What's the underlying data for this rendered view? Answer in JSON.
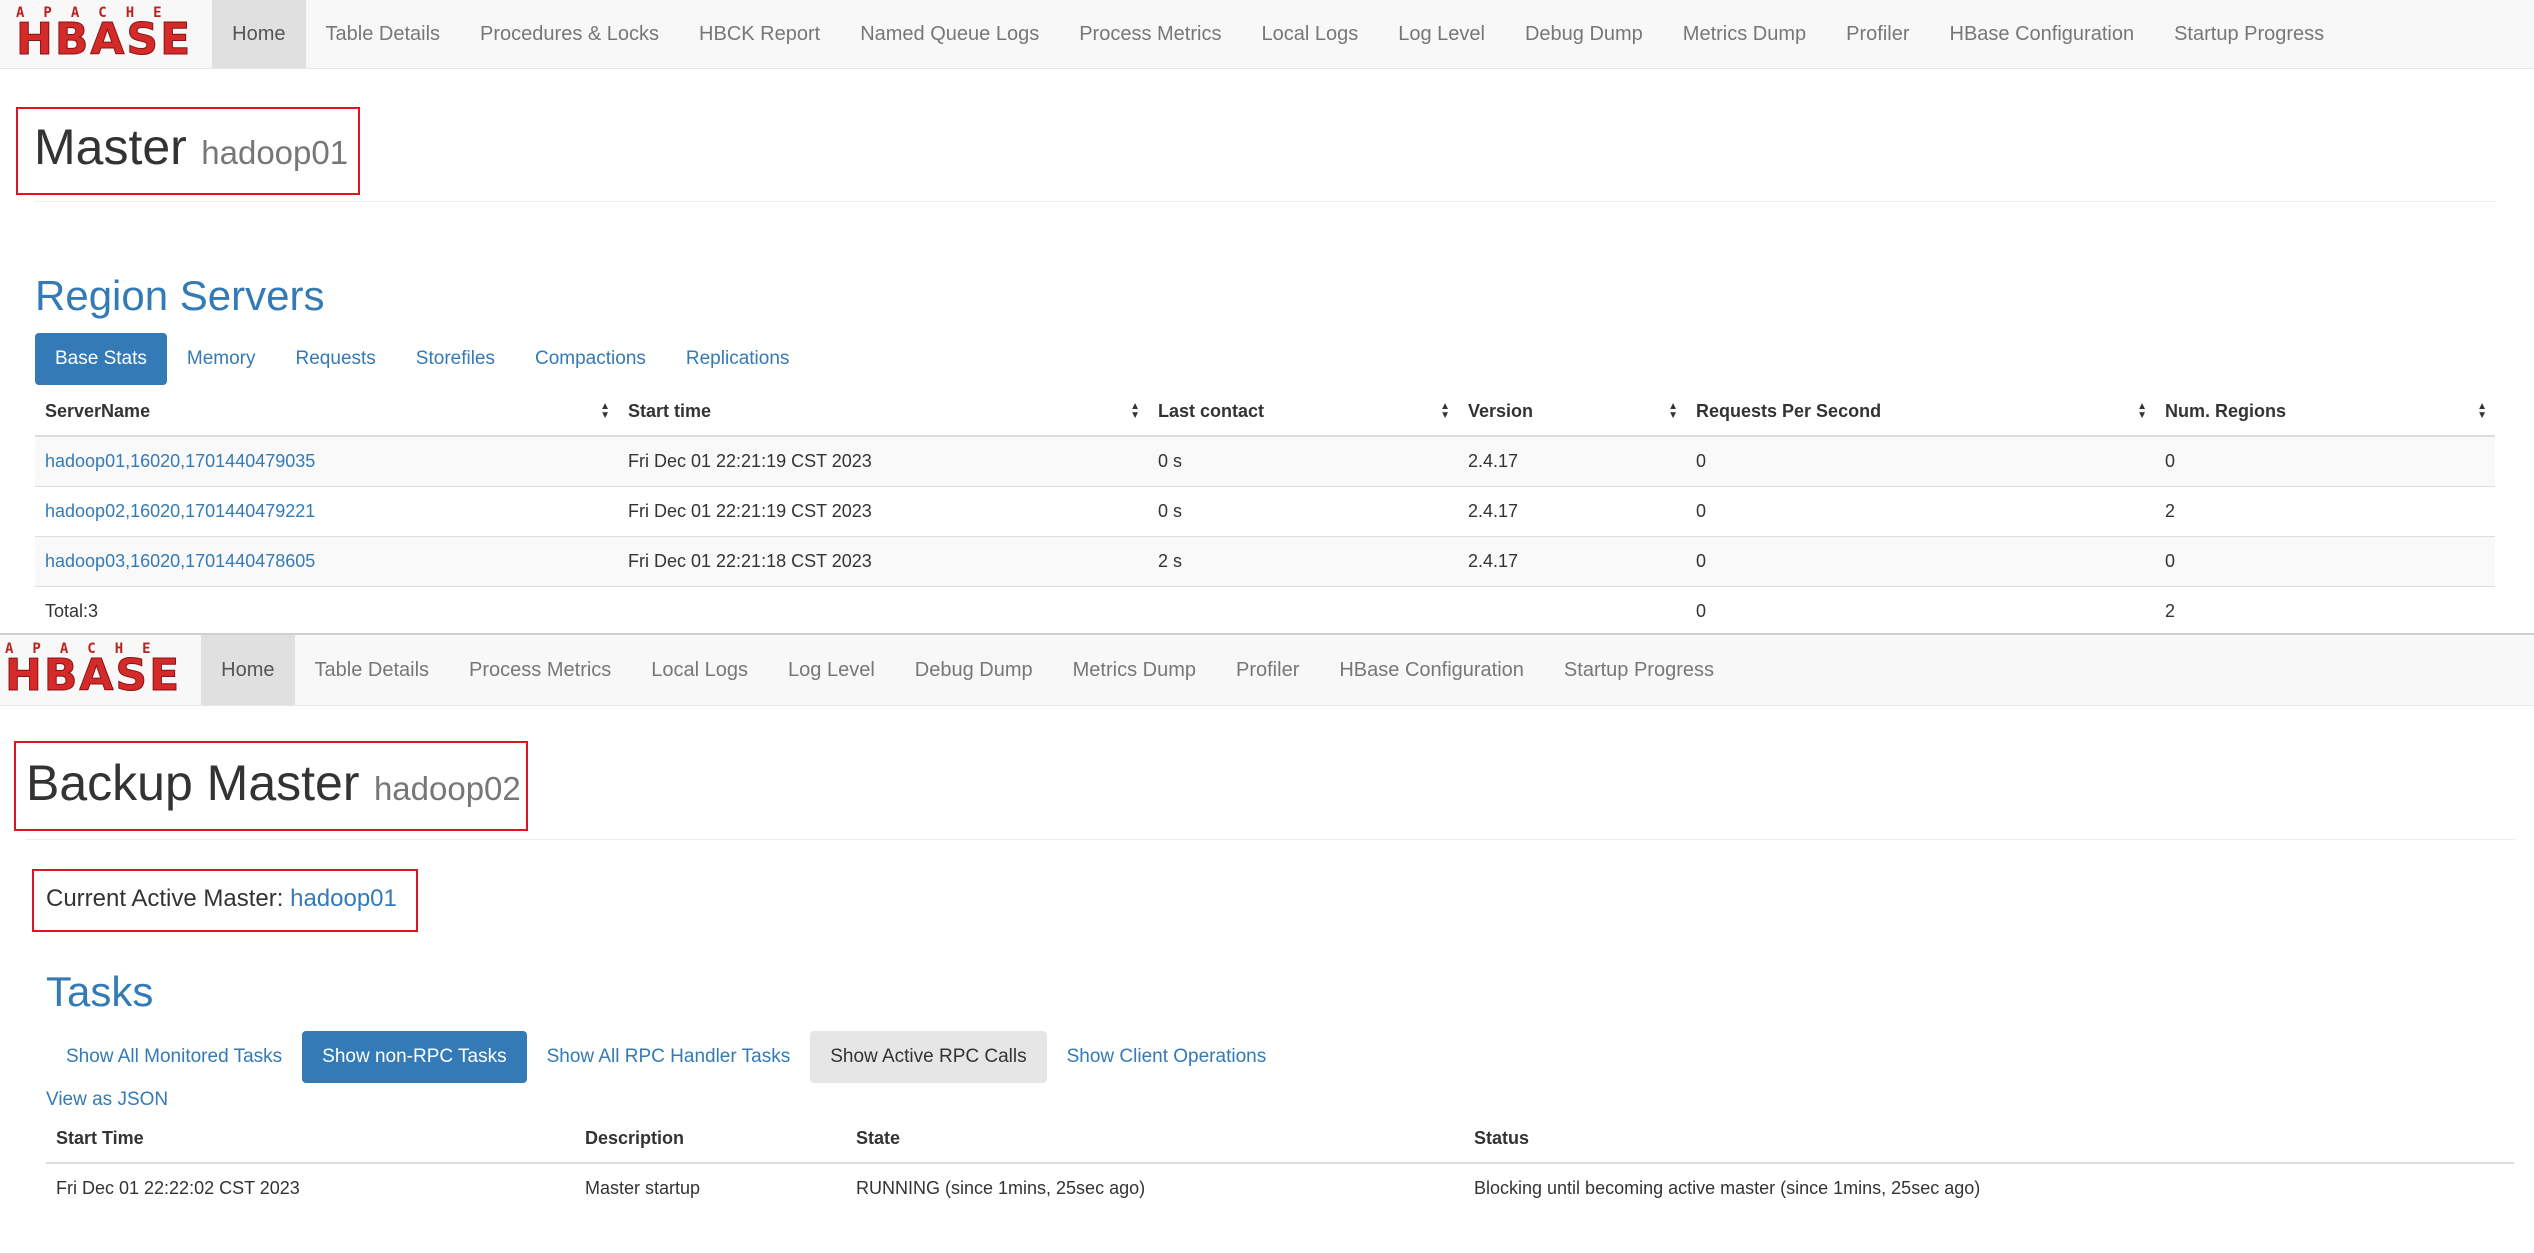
{
  "master_page": {
    "logo": {
      "apache": "APACHE",
      "hbase": "HBASE"
    },
    "nav": [
      "Home",
      "Table Details",
      "Procedures & Locks",
      "HBCK Report",
      "Named Queue Logs",
      "Process Metrics",
      "Local Logs",
      "Log Level",
      "Debug Dump",
      "Metrics Dump",
      "Profiler",
      "HBase Configuration",
      "Startup Progress"
    ],
    "header": {
      "title": "Master",
      "host": "hadoop01"
    },
    "region_servers": {
      "title": "Region Servers",
      "tabs": [
        "Base Stats",
        "Memory",
        "Requests",
        "Storefiles",
        "Compactions",
        "Replications"
      ],
      "columns": [
        "ServerName",
        "Start time",
        "Last contact",
        "Version",
        "Requests Per Second",
        "Num. Regions"
      ],
      "rows": [
        [
          "hadoop01,16020,1701440479035",
          "Fri Dec 01 22:21:19 CST 2023",
          "0 s",
          "2.4.17",
          "0",
          "0"
        ],
        [
          "hadoop02,16020,1701440479221",
          "Fri Dec 01 22:21:19 CST 2023",
          "0 s",
          "2.4.17",
          "0",
          "2"
        ],
        [
          "hadoop03,16020,1701440478605",
          "Fri Dec 01 22:21:18 CST 2023",
          "2 s",
          "2.4.17",
          "0",
          "0"
        ]
      ],
      "total": {
        "label": "Total:3",
        "requests": "0",
        "regions": "2"
      }
    }
  },
  "backup_page": {
    "logo": {
      "apache": "APACHE",
      "hbase": "HBASE"
    },
    "nav": [
      "Home",
      "Table Details",
      "Process Metrics",
      "Local Logs",
      "Log Level",
      "Debug Dump",
      "Metrics Dump",
      "Profiler",
      "HBase Configuration",
      "Startup Progress"
    ],
    "header": {
      "title": "Backup Master",
      "host": "hadoop02"
    },
    "active_master": {
      "label": "Current Active Master:",
      "value": "hadoop01"
    },
    "tasks": {
      "title": "Tasks",
      "tabs": [
        "Show All Monitored Tasks",
        "Show non-RPC Tasks",
        "Show All RPC Handler Tasks",
        "Show Active RPC Calls",
        "Show Client Operations"
      ],
      "view_json": "View as JSON",
      "columns": [
        "Start Time",
        "Description",
        "State",
        "Status"
      ],
      "rows": [
        [
          "Fri Dec 01 22:22:02 CST 2023",
          "Master startup",
          "RUNNING (since 1mins, 25sec ago)",
          "Blocking until becoming active master (since 1mins, 25sec ago)"
        ]
      ]
    }
  },
  "colors": {
    "link": "#337ab7",
    "highlight_box": "#e0141e",
    "logo_red": "#d42a2a"
  }
}
